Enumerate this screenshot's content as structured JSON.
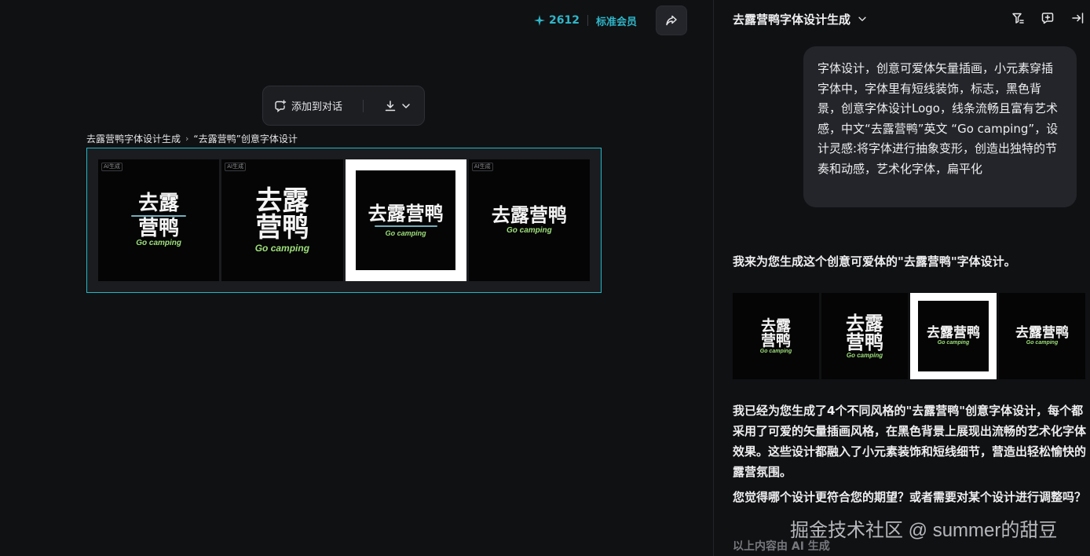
{
  "topbar": {
    "credits": "2612",
    "membership": "标准会员",
    "accent_color": "#2fb6c9"
  },
  "toolbar": {
    "add_to_chat": "添加到对话"
  },
  "breadcrumb": {
    "parent": "去露营鸭字体设计生成",
    "current": "“去露营鸭”创意字体设计"
  },
  "gallery": {
    "badge": "AI生成",
    "images": [
      {
        "cn_line1": "去露",
        "cn_line2": "营鸭",
        "en": "Go camping",
        "framed": false
      },
      {
        "cn_line1": "去露",
        "cn_line2": "营鸭",
        "en": "Go camping",
        "framed": false
      },
      {
        "cn_line1": "去露营鸭",
        "cn_line2": "",
        "en": "Go camping",
        "framed": true
      },
      {
        "cn_line1": "去露营鸭",
        "cn_line2": "",
        "en": "Go camping",
        "framed": false
      }
    ]
  },
  "chat": {
    "title": "去露营鸭字体设计生成",
    "user_message": "字体设计，创意可爱体矢量插画，小元素穿插字体中，字体里有短线装饰，标志，黑色背景，创意字体设计Logo，线条流畅且富有艺术感，中文“去露营鸭”英文 “Go camping”，设计灵感:将字体进行抽象变形，创造出独特的节奏和动感，艺术化字体，扁平化",
    "reply_intro": "我来为您生成这个创意可爱体的\"去露营鸭\"字体设计。",
    "reply_summary": "我已经为您生成了4个不同风格的\"去露营鸭\"创意字体设计，每个都采用了可爱的矢量插画风格，在黑色背景上展现出流畅的艺术化字体效果。这些设计都融入了小元素装饰和短线细节，营造出轻松愉快的露营氛围。",
    "reply_question": "您觉得哪个设计更符合您的期望？或者需要对某个设计进行调整吗？",
    "ai_note": "以上内容由 AI 生成"
  },
  "watermark": "掘金技术社区 @ summer的甜豆"
}
